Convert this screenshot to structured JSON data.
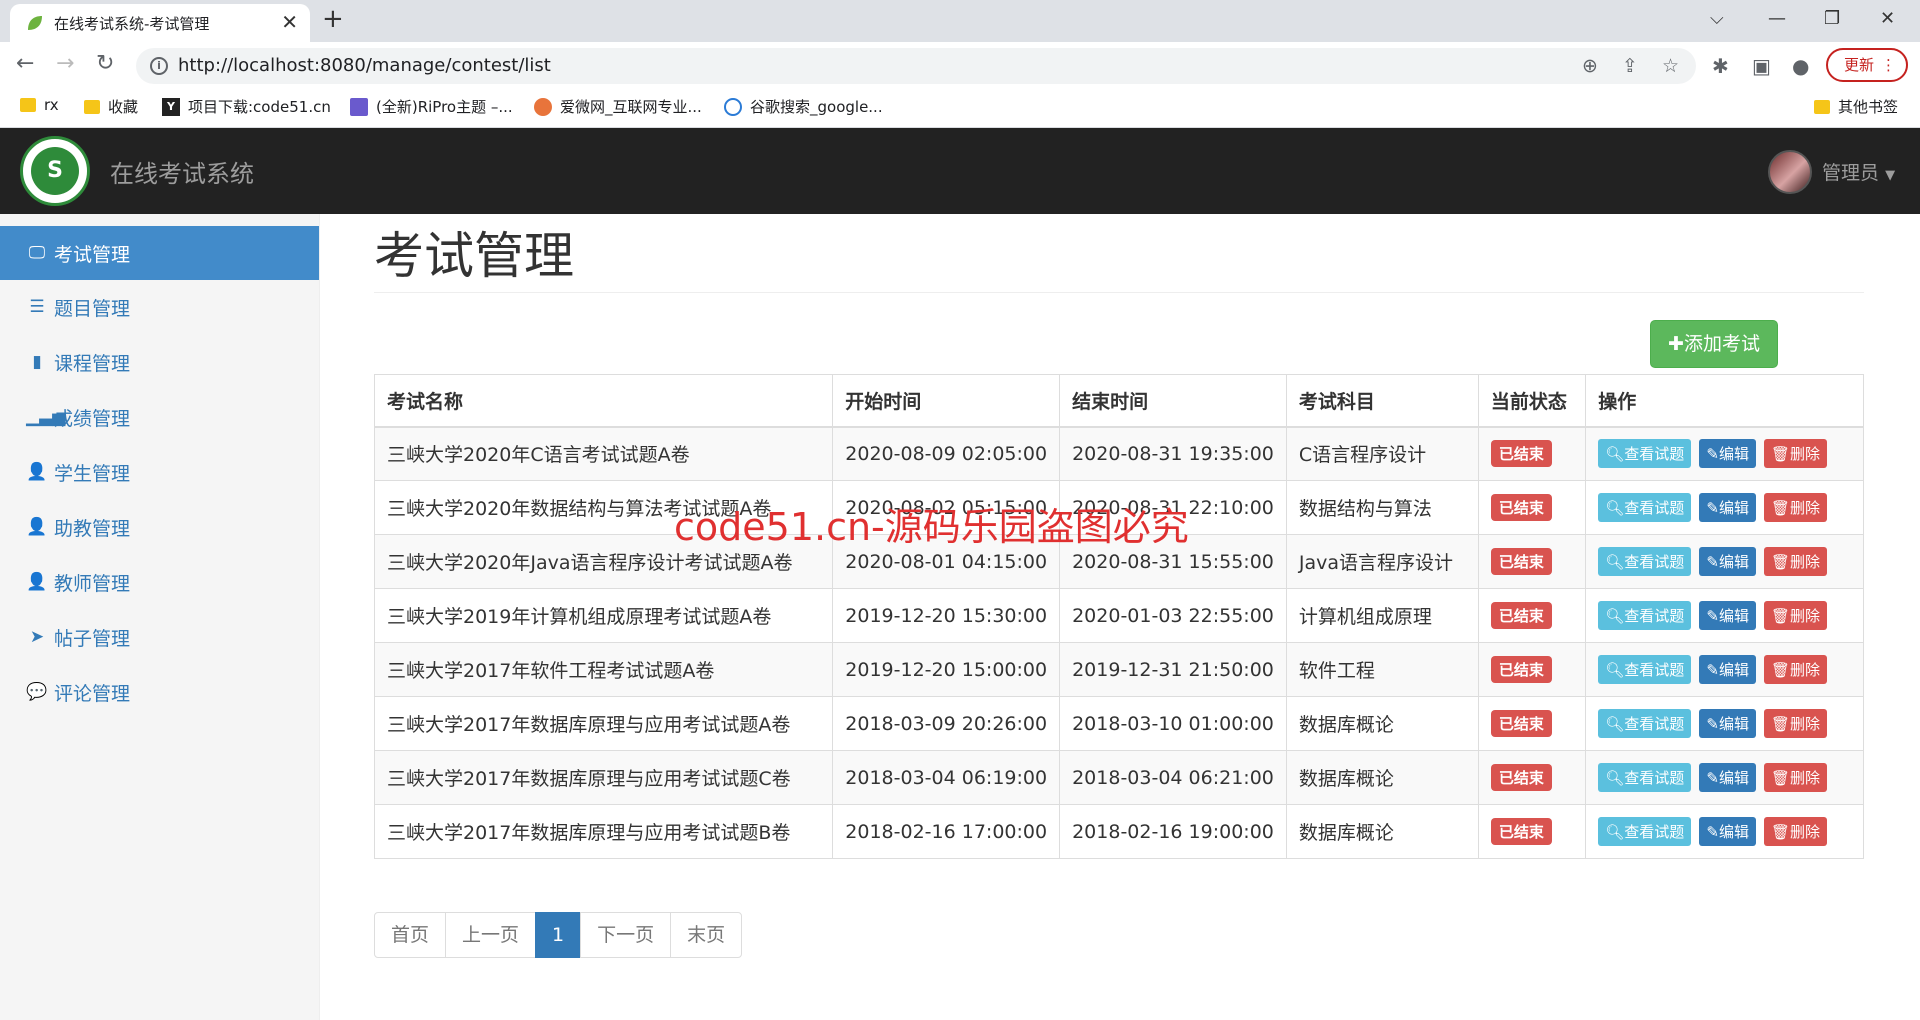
{
  "browser": {
    "tab_title": "在线考试系统-考试管理",
    "url": "http://localhost:8080/manage/contest/list",
    "update_label": "更新",
    "bookmarks": [
      {
        "label": "rx"
      },
      {
        "label": "收藏"
      },
      {
        "label": "项目下载:code51.cn"
      },
      {
        "label": "(全新)RiPro主题 –..."
      },
      {
        "label": "爱微网_互联网专业..."
      },
      {
        "label": "谷歌搜索_google..."
      }
    ],
    "other_bookmarks": "其他书签"
  },
  "app": {
    "brand": "在线考试系统",
    "user": "管理员"
  },
  "sidebar": {
    "items": [
      {
        "label": "考试管理",
        "icon": "monitor-icon"
      },
      {
        "label": "题目管理",
        "icon": "list-icon"
      },
      {
        "label": "课程管理",
        "icon": "book-icon"
      },
      {
        "label": "成绩管理",
        "icon": "signal-icon"
      },
      {
        "label": "学生管理",
        "icon": "user-icon"
      },
      {
        "label": "助教管理",
        "icon": "user-icon"
      },
      {
        "label": "教师管理",
        "icon": "user-icon"
      },
      {
        "label": "帖子管理",
        "icon": "send-icon"
      },
      {
        "label": "评论管理",
        "icon": "comment-icon"
      }
    ]
  },
  "main": {
    "title": "考试管理",
    "add_label": "✚添加考试",
    "columns": [
      "考试名称",
      "开始时间",
      "结束时间",
      "考试科目",
      "当前状态",
      "操作"
    ],
    "rows": [
      {
        "name": "三峡大学2020年C语言考试试题A卷",
        "start": "2020-08-09 02:05:00",
        "end": "2020-08-31 19:35:00",
        "subject": "C语言程序设计",
        "status": "已结束"
      },
      {
        "name": "三峡大学2020年数据结构与算法考试试题A卷",
        "start": "2020-08-02 05:15:00",
        "end": "2020-08-31 22:10:00",
        "subject": "数据结构与算法",
        "status": "已结束"
      },
      {
        "name": "三峡大学2020年Java语言程序设计考试试题A卷",
        "start": "2020-08-01 04:15:00",
        "end": "2020-08-31 15:55:00",
        "subject": "Java语言程序设计",
        "status": "已结束"
      },
      {
        "name": "三峡大学2019年计算机组成原理考试试题A卷",
        "start": "2019-12-20 15:30:00",
        "end": "2020-01-03 22:55:00",
        "subject": "计算机组成原理",
        "status": "已结束"
      },
      {
        "name": "三峡大学2017年软件工程考试试题A卷",
        "start": "2019-12-20 15:00:00",
        "end": "2019-12-31 21:50:00",
        "subject": "软件工程",
        "status": "已结束"
      },
      {
        "name": "三峡大学2017年数据库原理与应用考试试题A卷",
        "start": "2018-03-09 20:26:00",
        "end": "2018-03-10 01:00:00",
        "subject": "数据库概论",
        "status": "已结束"
      },
      {
        "name": "三峡大学2017年数据库原理与应用考试试题C卷",
        "start": "2018-03-04 06:19:00",
        "end": "2018-03-04 06:21:00",
        "subject": "数据库概论",
        "status": "已结束"
      },
      {
        "name": "三峡大学2017年数据库原理与应用考试试题B卷",
        "start": "2018-02-16 17:00:00",
        "end": "2018-02-16 19:00:00",
        "subject": "数据库概论",
        "status": "已结束"
      }
    ],
    "actions": {
      "view": "查看试题",
      "edit": "编辑",
      "delete": "删除"
    },
    "pagination": [
      "首页",
      "上一页",
      "1",
      "下一页",
      "末页"
    ],
    "current_page": "1"
  },
  "watermark": "code51.cn-源码乐园盗图必究",
  "colors": {
    "accent": "#428bca",
    "success": "#5cb85c",
    "danger": "#d9534f",
    "info": "#5bc0de",
    "primary": "#337ab7"
  }
}
